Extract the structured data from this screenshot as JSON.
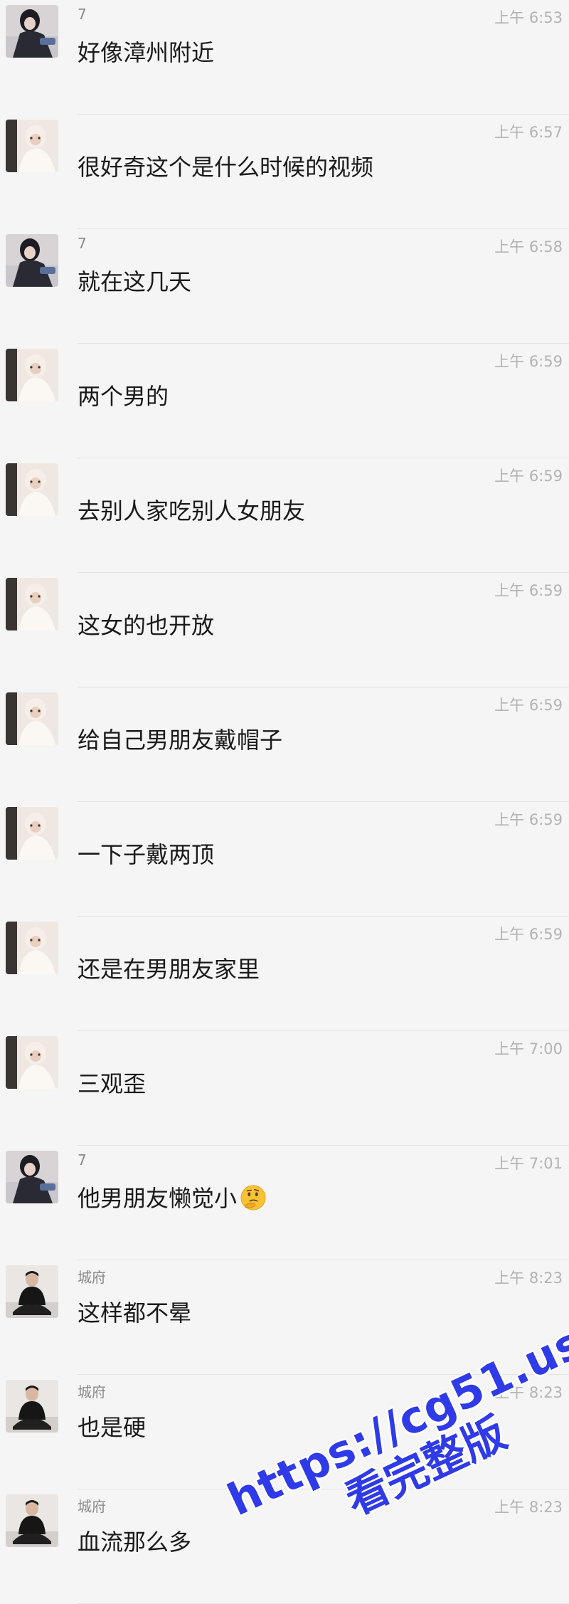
{
  "messages": [
    {
      "avatar": "avatar-dark",
      "sender": "7",
      "time": "上午 6:53",
      "text": "好像漳州附近"
    },
    {
      "avatar": "avatar-light",
      "sender": "",
      "time": "上午 6:57",
      "text": "很好奇这个是什么时候的视频"
    },
    {
      "avatar": "avatar-dark",
      "sender": "7",
      "time": "上午 6:58",
      "text": "就在这几天"
    },
    {
      "avatar": "avatar-light",
      "sender": "",
      "time": "上午 6:59",
      "text": "两个男的"
    },
    {
      "avatar": "avatar-light",
      "sender": "",
      "time": "上午 6:59",
      "text": "去别人家吃别人女朋友"
    },
    {
      "avatar": "avatar-light",
      "sender": "",
      "time": "上午 6:59",
      "text": "这女的也开放"
    },
    {
      "avatar": "avatar-light",
      "sender": "",
      "time": "上午 6:59",
      "text": "给自己男朋友戴帽子"
    },
    {
      "avatar": "avatar-light",
      "sender": "",
      "time": "上午 6:59",
      "text": "一下子戴两顶"
    },
    {
      "avatar": "avatar-light",
      "sender": "",
      "time": "上午 6:59",
      "text": "还是在男朋友家里"
    },
    {
      "avatar": "avatar-light",
      "sender": "",
      "time": "上午 7:00",
      "text": "三观歪"
    },
    {
      "avatar": "avatar-dark",
      "sender": "7",
      "time": "上午 7:01",
      "text": "他男朋友懒觉小",
      "emoji": "thinking-face-emoji"
    },
    {
      "avatar": "avatar-person",
      "sender": "城府",
      "time": "上午 8:23",
      "text": "这样都不晕"
    },
    {
      "avatar": "avatar-person",
      "sender": "城府",
      "time": "上午 8:23",
      "text": "也是硬"
    },
    {
      "avatar": "avatar-person",
      "sender": "城府",
      "time": "上午 8:23",
      "text": "血流那么多"
    }
  ],
  "watermark": {
    "url": "https://cg51.us",
    "subtitle": "看完整版"
  },
  "colors": {
    "background": "#f5f5f5",
    "text": "#1a1a1a",
    "meta": "#b3b3b3",
    "watermark": "#2f3be8"
  }
}
